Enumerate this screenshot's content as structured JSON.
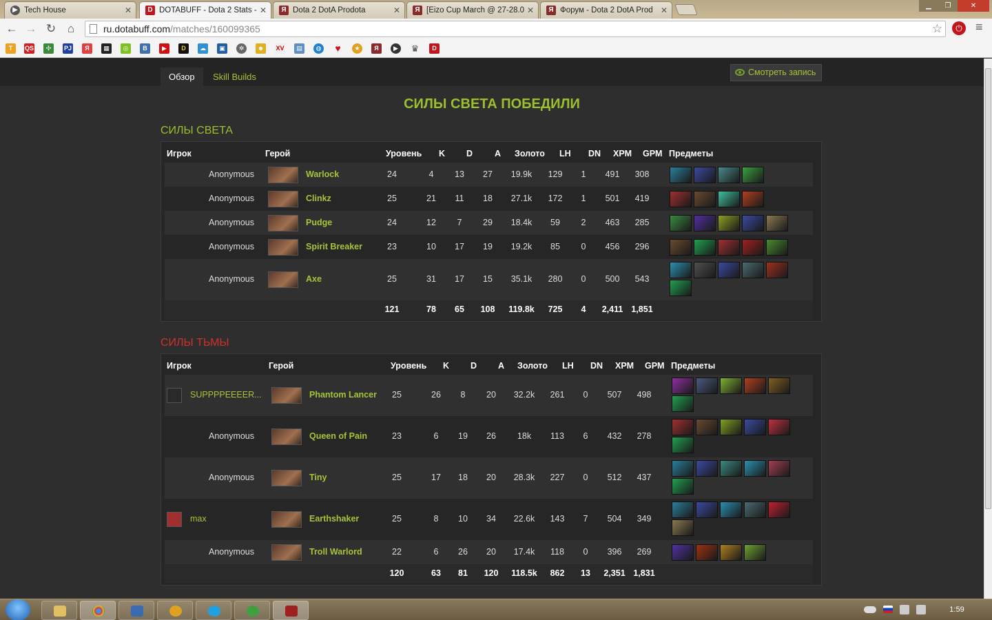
{
  "browser": {
    "tabs": [
      {
        "title": "Tech House",
        "icon": "play-icon"
      },
      {
        "title": "DOTABUFF - Dota 2 Stats -",
        "icon": "dotabuff-icon"
      },
      {
        "title": "Dota 2 DotA Prodota",
        "icon": "prodota-icon"
      },
      {
        "title": "[Eizo Cup March @ 27-28.0",
        "icon": "prodota-icon"
      },
      {
        "title": "Форум - Dota 2 DotA Prod",
        "icon": "prodota-icon"
      }
    ],
    "url_host": "ru.dotabuff.com",
    "url_path": "/matches/160099365"
  },
  "page": {
    "tabs": [
      {
        "label": "Обзор",
        "active": true
      },
      {
        "label": "Skill Builds",
        "active": false
      }
    ],
    "watch_label": "Смотреть запись",
    "result_title": "СИЛЫ СВЕТА ПОБЕДИЛИ",
    "headers": {
      "player": "Игрок",
      "hero": "Герой",
      "level": "Уровень",
      "k": "K",
      "d": "D",
      "a": "A",
      "gold": "Золото",
      "lh": "LH",
      "dn": "DN",
      "xpm": "XPM",
      "gpm": "GPM",
      "items": "Предметы"
    },
    "radiant": {
      "title": "СИЛЫ СВЕТА",
      "players": [
        {
          "player": "Anonymous",
          "hero": "Warlock",
          "level": "24",
          "k": "4",
          "d": "13",
          "a": "27",
          "gold": "19.9k",
          "lh": "129",
          "dn": "1",
          "xpm": "491",
          "gpm": "308",
          "items": [
            "#2a7f9a",
            "#3a4aa0",
            "#4a8a8a",
            "#3aa040"
          ]
        },
        {
          "player": "Anonymous",
          "hero": "Clinkz",
          "level": "25",
          "k": "21",
          "d": "11",
          "a": "18",
          "gold": "27.1k",
          "lh": "172",
          "dn": "1",
          "xpm": "501",
          "gpm": "419",
          "items": [
            "#a03030",
            "#6a4a30",
            "#40c0a0",
            "#b04020"
          ]
        },
        {
          "player": "Anonymous",
          "hero": "Pudge",
          "level": "24",
          "k": "12",
          "d": "7",
          "a": "29",
          "gold": "18.4k",
          "lh": "59",
          "dn": "2",
          "xpm": "463",
          "gpm": "285",
          "items": [
            "#3a8a40",
            "#5030a0",
            "#90a020",
            "#3a4aa0",
            "#8a7a50"
          ]
        },
        {
          "player": "Anonymous",
          "hero": "Spirit Breaker",
          "level": "23",
          "k": "10",
          "d": "17",
          "a": "19",
          "gold": "19.2k",
          "lh": "85",
          "dn": "0",
          "xpm": "456",
          "gpm": "296",
          "items": [
            "#6a4a30",
            "#20a050",
            "#a03030",
            "#a02020",
            "#4a8a30"
          ]
        },
        {
          "player": "Anonymous",
          "hero": "Axe",
          "level": "25",
          "k": "31",
          "d": "17",
          "a": "15",
          "gold": "35.1k",
          "lh": "280",
          "dn": "0",
          "xpm": "500",
          "gpm": "543",
          "items": [
            "#2a90b0",
            "#505050",
            "#3a4aa0",
            "#4a6a70",
            "#a03020",
            "#20a050"
          ]
        }
      ],
      "totals": {
        "level": "121",
        "k": "78",
        "d": "65",
        "a": "108",
        "gold": "119.8k",
        "lh": "725",
        "dn": "4",
        "xpm": "2,411",
        "gpm": "1,851"
      }
    },
    "dire": {
      "title": "СИЛЫ ТЬМЫ",
      "players": [
        {
          "player": "SUPPPPEEEER...",
          "registered": true,
          "avatar": "#2a2a2a",
          "hero": "Phantom Lancer",
          "level": "25",
          "k": "26",
          "d": "8",
          "a": "20",
          "gold": "32.2k",
          "lh": "261",
          "dn": "0",
          "xpm": "507",
          "gpm": "498",
          "items": [
            "#9030a0",
            "#4a5a80",
            "#80b030",
            "#b04020",
            "#806020",
            "#20a050"
          ]
        },
        {
          "player": "Anonymous",
          "hero": "Queen of Pain",
          "level": "23",
          "k": "6",
          "d": "19",
          "a": "26",
          "gold": "18k",
          "lh": "113",
          "dn": "6",
          "xpm": "432",
          "gpm": "278",
          "items": [
            "#a03030",
            "#6a4a30",
            "#80a020",
            "#3a4aa0",
            "#c03040",
            "#20a050"
          ]
        },
        {
          "player": "Anonymous",
          "hero": "Tiny",
          "level": "25",
          "k": "17",
          "d": "18",
          "a": "20",
          "gold": "28.3k",
          "lh": "227",
          "dn": "0",
          "xpm": "512",
          "gpm": "437",
          "items": [
            "#2a7f9a",
            "#3a4aa0",
            "#3a8a80",
            "#2a90b0",
            "#a04050",
            "#20a050"
          ]
        },
        {
          "player": "max",
          "registered": true,
          "avatar": "#a03030",
          "hero": "Earthshaker",
          "level": "25",
          "k": "8",
          "d": "10",
          "a": "34",
          "gold": "22.6k",
          "lh": "143",
          "dn": "7",
          "xpm": "504",
          "gpm": "349",
          "items": [
            "#2a7f9a",
            "#3a4aa0",
            "#2a90b0",
            "#4a6a70",
            "#c02030",
            "#8a7a50"
          ]
        },
        {
          "player": "Anonymous",
          "hero": "Troll Warlord",
          "level": "22",
          "k": "6",
          "d": "26",
          "a": "20",
          "gold": "17.4k",
          "lh": "118",
          "dn": "0",
          "xpm": "396",
          "gpm": "269",
          "items": [
            "#5030a0",
            "#a03010",
            "#b08020",
            "#70a030"
          ]
        }
      ],
      "totals": {
        "level": "120",
        "k": "63",
        "d": "81",
        "a": "120",
        "gold": "118.5k",
        "lh": "862",
        "dn": "13",
        "xpm": "2,351",
        "gpm": "1,831"
      }
    }
  },
  "taskbar": {
    "clock": "1:59",
    "apps": [
      "explorer-icon",
      "chrome-icon",
      "monitor-icon",
      "game-icon",
      "skype-icon",
      "utorrent-icon",
      "dota-icon"
    ]
  }
}
